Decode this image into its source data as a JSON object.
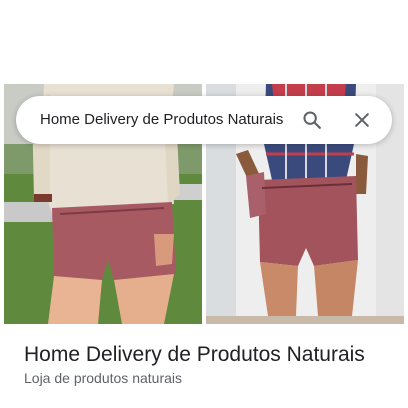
{
  "search": {
    "query": "Home Delivery de Produtos Naturais"
  },
  "icons": {
    "search": "search-icon",
    "clear": "close-icon"
  },
  "place": {
    "name": "Home Delivery de Produtos Naturais",
    "category": "Loja de produtos naturais"
  },
  "colors": {
    "text_primary": "#202124",
    "text_secondary": "#5f6368",
    "icon": "#5f6368"
  }
}
